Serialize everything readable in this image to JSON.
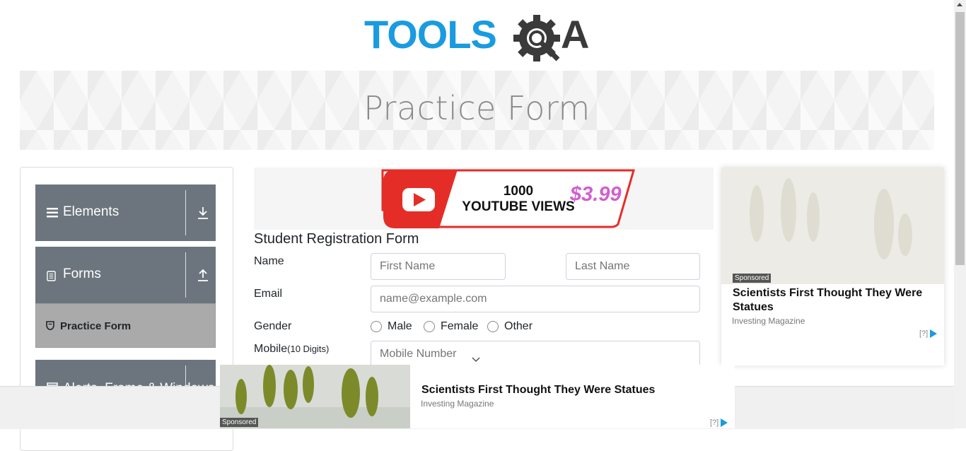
{
  "logo": {
    "text_left": "TOOLS",
    "text_right": "A"
  },
  "banner": {
    "title": "Practice Form"
  },
  "sidebar": {
    "groups": [
      {
        "label": "Elements",
        "icon": "hamburger-icon"
      },
      {
        "label": "Forms",
        "icon": "document-icon"
      },
      {
        "label": "Alerts, Frame & Windows",
        "icon": "window-icon"
      }
    ],
    "sub_item": {
      "label": "Practice Form",
      "icon": "shield-icon"
    }
  },
  "yt_ad": {
    "count": "1000",
    "caption": "YOUTUBE VIEWS",
    "price": "$3.99"
  },
  "form": {
    "title": "Student Registration Form",
    "name_label": "Name",
    "first_name_placeholder": "First Name",
    "last_name_placeholder": "Last Name",
    "email_label": "Email",
    "email_placeholder": "name@example.com",
    "gender_label": "Gender",
    "gender_options": [
      "Male",
      "Female",
      "Other"
    ],
    "mobile_label": "Mobile",
    "mobile_hint": "(10 Digits)",
    "mobile_placeholder": "Mobile Number"
  },
  "side_ad": {
    "badge": "Sponsored",
    "headline": "Scientists First Thought They Were Statues",
    "source": "Investing Magazine",
    "adchoice": "[?]"
  },
  "bottom_ad": {
    "badge": "Sponsored",
    "headline": "Scientists First Thought They Were Statues",
    "source": "Investing Magazine",
    "adchoice": "[?]"
  },
  "colors": {
    "brand_blue": "#1a9be0",
    "brand_dark": "#333333",
    "sidebar_group": "#6c757d",
    "sidebar_active": "#aaaaaa",
    "yt_red": "#e52d27"
  }
}
